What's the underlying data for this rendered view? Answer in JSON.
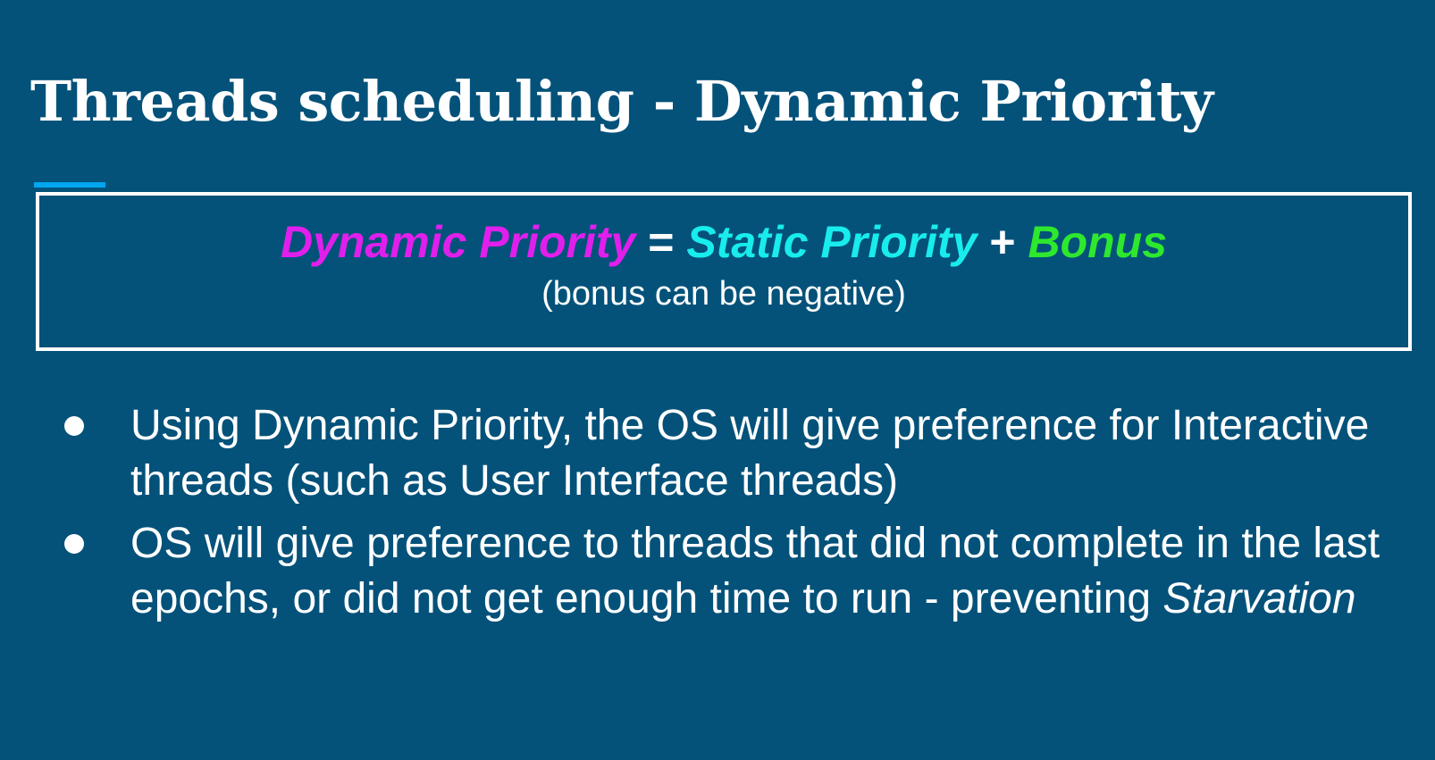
{
  "slide": {
    "title": "Threads scheduling - Dynamic Priority",
    "formula": {
      "lhs": "Dynamic Priority",
      "equals": "=",
      "term1": "Static Priority",
      "plus": "+",
      "term2": "Bonus",
      "note": "(bonus can be negative)"
    },
    "bullets": [
      {
        "text": "Using Dynamic Priority, the OS will give preference for Interactive threads (such as User Interface threads)"
      },
      {
        "text": "OS will give preference to threads that did not complete in the last epochs, or did not get enough time to run - preventing ",
        "emphasis": "Starvation"
      }
    ]
  },
  "colors": {
    "background": "#04527a",
    "title_underline": "#00a6f0",
    "dynamic_priority": "#e11fec",
    "static_priority": "#18ecec",
    "bonus": "#2ee82e",
    "text": "#ffffff"
  },
  "icons": {
    "bullet": "bullet-dot-icon"
  }
}
